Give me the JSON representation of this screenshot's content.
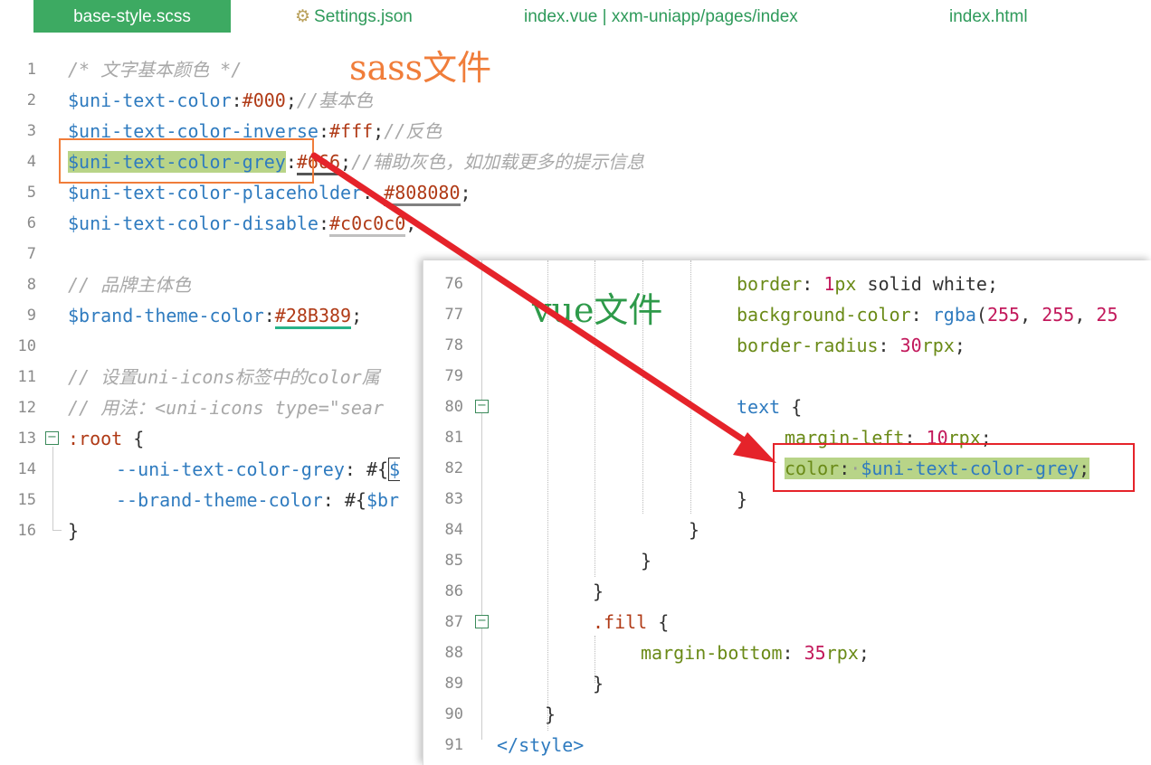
{
  "tabs": [
    {
      "label": "base-style.scss",
      "active": true
    },
    {
      "label": "Settings.json",
      "icon": "gear-icon"
    },
    {
      "label": "index.vue | xxm-uniapp/pages/index"
    },
    {
      "label": "index.html"
    }
  ],
  "annotations": {
    "sass": "sass文件",
    "vue": "vue文件"
  },
  "sass_lines": {
    "l1": {
      "n": "1",
      "comment": "/* 文字基本颜色 */"
    },
    "l2": {
      "n": "2",
      "name": "$uni-text-color",
      "colon": ":",
      "value": "#000",
      "semi": ";",
      "comment": "//基本色"
    },
    "l3": {
      "n": "3",
      "name": "$uni-text-color-inverse",
      "colon": ":",
      "value": "#fff",
      "semi": ";",
      "comment": "//反色"
    },
    "l4": {
      "n": "4",
      "name": "$uni-text-color-grey",
      "colon": ":",
      "value": "#666",
      "semi": ";",
      "comment": "//辅助灰色，如加载更多的提示信息"
    },
    "l5": {
      "n": "5",
      "name": "$uni-text-color-placeholder",
      "colon": ": ",
      "value": "#808080",
      "semi": ";"
    },
    "l6": {
      "n": "6",
      "name": "$uni-text-color-disable",
      "colon": ":",
      "value": "#c0c0c0",
      "semi": ";"
    },
    "l7": {
      "n": "7"
    },
    "l8": {
      "n": "8",
      "comment": "// 品牌主体色"
    },
    "l9": {
      "n": "9",
      "name": "$brand-theme-color",
      "colon": ":",
      "value": "#28B389",
      "semi": ";"
    },
    "l10": {
      "n": "10"
    },
    "l11": {
      "n": "11",
      "comment": "// 设置uni-icons标签中的color属"
    },
    "l12": {
      "n": "12",
      "comment": "// 用法：<uni-icons type=\"sear"
    },
    "l13": {
      "n": "13",
      "code": ":root",
      "brace": " {"
    },
    "l14": {
      "n": "14",
      "prop": "--uni-text-color-grey",
      "rest": ": #{",
      "tail": "$"
    },
    "l15": {
      "n": "15",
      "prop": "--brand-theme-color",
      "rest": ": #{",
      "tail": "$br"
    },
    "l16": {
      "n": "16",
      "code": "}"
    }
  },
  "vue_lines": {
    "l76": {
      "n": "76",
      "prop": "border",
      "colon": ": ",
      "num": "1",
      "unit": "px",
      "rest": " solid white;"
    },
    "l77": {
      "n": "77",
      "prop": "background-color",
      "colon": ": ",
      "fn": "rgba",
      "open": "(",
      "a": "255",
      "sep1": ", ",
      "b": "255",
      "sep2": ", ",
      "c": "25"
    },
    "l78": {
      "n": "78",
      "prop": "border-radius",
      "colon": ": ",
      "num": "30",
      "unit": "rpx",
      "semi": ";"
    },
    "l79": {
      "n": "79"
    },
    "l80": {
      "n": "80",
      "code": "text",
      "brace": " {"
    },
    "l81": {
      "n": "81",
      "prop": "margin-left",
      "colon": ": ",
      "num": "10",
      "unit": "rpx",
      "semi": ";"
    },
    "l82": {
      "n": "82",
      "prop": "color",
      "colon": ":",
      "dot": "·",
      "value": "$uni-text-color-grey",
      "semi": ";"
    },
    "l83": {
      "n": "83",
      "code": "}"
    },
    "l84": {
      "n": "84",
      "code": "}"
    },
    "l85": {
      "n": "85",
      "code": "}"
    },
    "l86": {
      "n": "86",
      "code": "}"
    },
    "l87": {
      "n": "87",
      "code": ".fill",
      "brace": " {"
    },
    "l88": {
      "n": "88",
      "prop": "margin-bottom",
      "colon": ": ",
      "num": "35",
      "unit": "rpx",
      "semi": ";"
    },
    "l89": {
      "n": "89",
      "code": "}"
    },
    "l90": {
      "n": "90",
      "code": "}"
    },
    "l91": {
      "n": "91",
      "code": "</style>"
    }
  },
  "colors": {
    "arrow": "#e5232a",
    "tab_active": "#3daa62",
    "highlight": "#b8d488",
    "sass_note": "#f07d3a",
    "vue_note": "#2e9a4a"
  }
}
